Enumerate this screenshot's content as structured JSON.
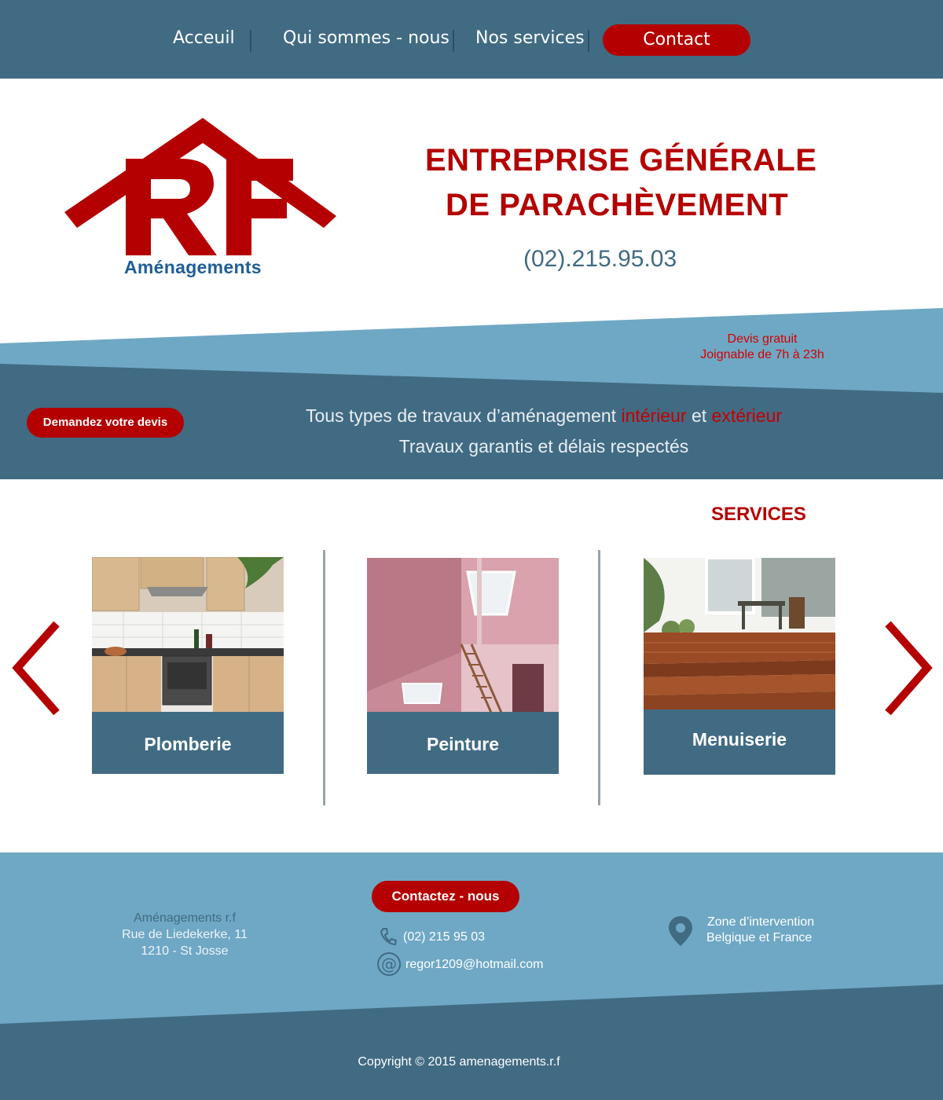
{
  "nav": {
    "items": [
      "Acceuil",
      "Qui sommes - nous",
      "Nos services"
    ],
    "contact": "Contact"
  },
  "header": {
    "logo_text": "Aménagements",
    "headline_1": "ENTREPRISE GÉNÉRALE",
    "headline_2": "DE PARACHÈVEMENT",
    "phone": "(02).215.95.03"
  },
  "band": {
    "devis_gratuit": "Devis gratuit",
    "hours": "Joignable de 7h à 23h",
    "devis_button": "Demandez votre devis",
    "tagline_prefix": "Tous types de travaux d’aménagement ",
    "tagline_interieur": "intérieur",
    "tagline_and": " et ",
    "tagline_exterieur": "extérieur",
    "tagline_2": "Travaux garantis et délais respectés"
  },
  "services": {
    "title": "SERVICES",
    "cards": [
      {
        "label": "Plomberie",
        "image": "kitchen-photo"
      },
      {
        "label": "Peinture",
        "image": "attic-room-photo"
      },
      {
        "label": "Menuiserie",
        "image": "wood-deck-photo"
      }
    ],
    "prev_icon": "chevron-left-icon",
    "next_icon": "chevron-right-icon"
  },
  "footer": {
    "address": {
      "name": "Aménagements r.f",
      "street": "Rue de Liedekerke, 11",
      "city": "1210 - St Josse"
    },
    "contact_button": "Contactez - nous",
    "phone": "(02) 215 95 03",
    "email": "regor1209@hotmail.com",
    "zone_1": "Zone d’intervention",
    "zone_2": "Belgique et France",
    "copyright": "Copyright © 2015 amenagements.r.f"
  },
  "colors": {
    "dark_blue": "#416b83",
    "light_blue": "#6fa8c4",
    "red": "#b40000"
  }
}
